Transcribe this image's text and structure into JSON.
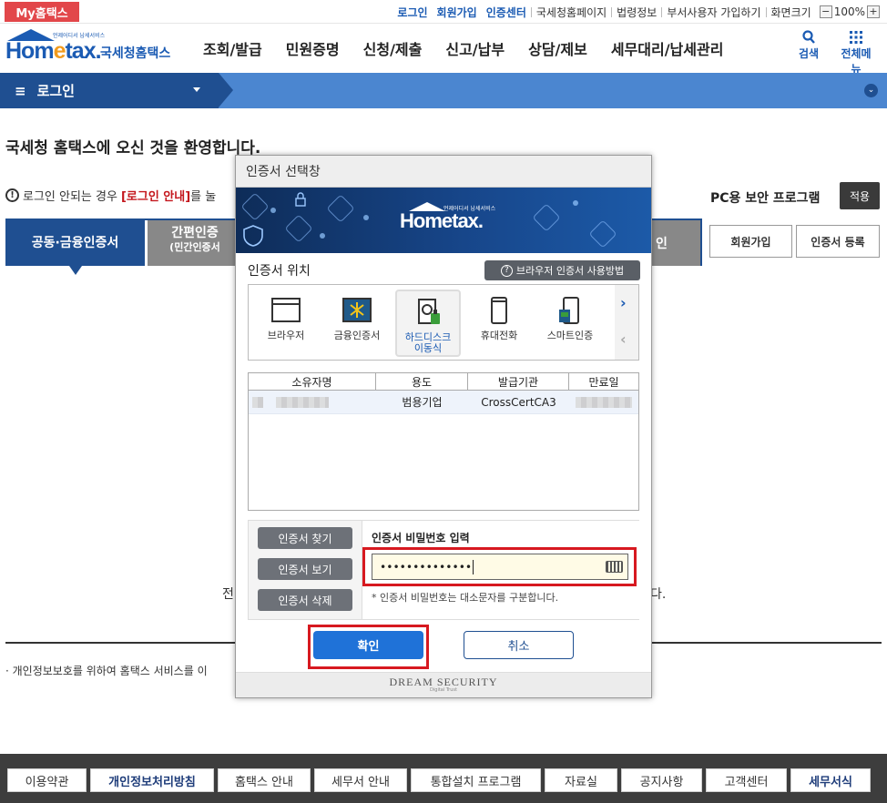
{
  "topbar": {
    "my_hometax": "My홈택스",
    "links_blue": [
      "로그인",
      "회원가입",
      "인증센터"
    ],
    "links": [
      "국세청홈페이지",
      "법령정보",
      "부서사용자 가입하기",
      "화면크기"
    ],
    "zoom_minus": "−",
    "zoom_value": "100%",
    "zoom_plus": "+"
  },
  "header": {
    "logo_word_a": "Hom",
    "logo_word_e": "e",
    "logo_word_b": "tax.",
    "logo_tiny": "언제어디서 납세서비스",
    "logo_sub": "국세청홈택스",
    "menus": [
      "조회/발급",
      "민원증명",
      "신청/제출",
      "신고/납부",
      "상담/제보",
      "세무대리/납세관리"
    ],
    "search_label": "검색",
    "allmenu_label": "전체메뉴",
    "search_icon": "search-icon",
    "grid_icon": "grid-icon"
  },
  "nav": {
    "menu_glyph": "≡",
    "crumb": "로그인",
    "circle_glyph": "⌄"
  },
  "page": {
    "welcome": "국세청 홈택스에 오신 것을 환영합니다.",
    "notice_icon": "!",
    "notice_prefix": "로그인 안되는 경우",
    "notice_link": "[로그인 안내]",
    "notice_suffix": "를 눌",
    "pc_security": "PC용 보안 프로그램",
    "apply": "적용",
    "tab_active": "공동·금융인증서",
    "tab_inactive": "간편인증",
    "tab_inactive_sub": "(민간인증서",
    "tab_right": "인",
    "side_join": "회원가입",
    "side_register": "인증서 등록",
    "stray_left": "전",
    "stray_right": "다.",
    "privacy": "· 개인정보보호를 위하여 홈택스 서비스를 이"
  },
  "footer": {
    "items": [
      {
        "label": "이용약관",
        "bold": false
      },
      {
        "label": "개인정보처리방침",
        "bold": true
      },
      {
        "label": "홈택스 안내",
        "bold": false
      },
      {
        "label": "세무서 안내",
        "bold": false
      },
      {
        "label": "통합설치 프로그램",
        "bold": false
      },
      {
        "label": "자료실",
        "bold": false
      },
      {
        "label": "공지사항",
        "bold": false
      },
      {
        "label": "고객센터",
        "bold": false
      },
      {
        "label": "세무서식",
        "bold": true
      }
    ]
  },
  "modal": {
    "title": "인증서 선택창",
    "banner_word": "Hometax.",
    "banner_tiny": "언제어디서 납세서비스",
    "location_label": "인증서 위치",
    "help_btn": "브라우저 인증서 사용방법",
    "help_icon": "?",
    "locations": [
      {
        "label": "브라우저",
        "icon": "browser-icon",
        "selected": false
      },
      {
        "label": "금융인증서",
        "icon": "finance-cert-icon",
        "selected": false
      },
      {
        "label": "하드디스크\n이동식",
        "icon": "harddisk-icon",
        "selected": true
      },
      {
        "label": "휴대전화",
        "icon": "phone-icon",
        "selected": false
      },
      {
        "label": "스마트인증",
        "icon": "smart-cert-icon",
        "selected": false
      }
    ],
    "arrow_right": "›",
    "arrow_left": "‹",
    "columns": [
      "소유자명",
      "용도",
      "발급기관",
      "만료일"
    ],
    "rows": [
      {
        "owner": "",
        "usage": "범용기업",
        "issuer": "CrossCertCA3",
        "expiry": ""
      }
    ],
    "btn_find": "인증서 찾기",
    "btn_view": "인증서 보기",
    "btn_delete": "인증서 삭제",
    "pw_label": "인증서 비밀번호 입력",
    "pw_value": "••••••••••••••",
    "pw_note": "* 인증서 비밀번호는 대소문자를 구분합니다.",
    "keyboard_icon": "keyboard-icon",
    "confirm": "확인",
    "cancel": "취소",
    "brand": "DREAM SECURITY",
    "brand_tag": "Digital Trust",
    "highlight_color": "#d71920"
  }
}
